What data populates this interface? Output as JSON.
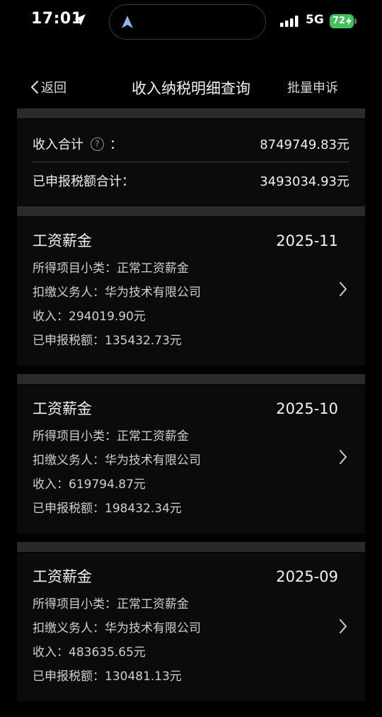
{
  "status_bar": {
    "time": "17:01",
    "network": "5G",
    "battery": "72"
  },
  "nav": {
    "back_label": "返回",
    "title": "收入纳税明细查询",
    "appeal_label": "批量申诉"
  },
  "summary": {
    "income_label": "收入合计",
    "income_colon": "：",
    "income_value": "8749749.83元",
    "tax_label": "已申报税额合计：",
    "tax_value": "3493034.93元"
  },
  "records": [
    {
      "title": "工资薪金",
      "period": "2025-11",
      "subcategory": "所得项目小类：正常工资薪金",
      "withholder": "扣缴义务人：华为技术有限公司",
      "income": "收入：294019.90元",
      "tax": "已申报税额：135432.73元"
    },
    {
      "title": "工资薪金",
      "period": "2025-10",
      "subcategory": "所得项目小类：正常工资薪金",
      "withholder": "扣缴义务人：华为技术有限公司",
      "income": "收入：619794.87元",
      "tax": "已申报税额：198432.34元"
    },
    {
      "title": "工资薪金",
      "period": "2025-09",
      "subcategory": "所得项目小类：正常工资薪金",
      "withholder": "扣缴义务人：华为技术有限公司",
      "income": "收入：483635.65元",
      "tax": "已申报税额：130481.13元"
    }
  ]
}
